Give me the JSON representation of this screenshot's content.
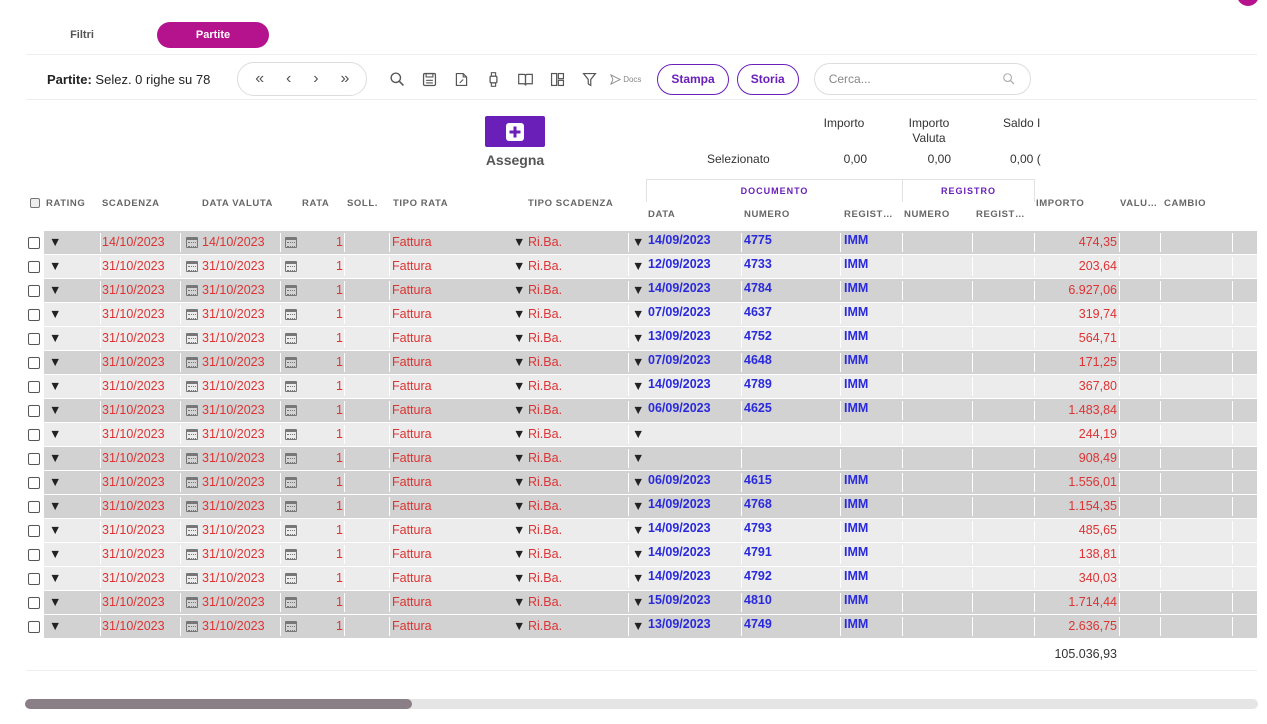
{
  "tabs": [
    {
      "label": "Filtri",
      "active": false
    },
    {
      "label": "Partite",
      "active": true
    }
  ],
  "toolbar": {
    "title": "Partite:",
    "selection_text": "Selez. 0 righe su 78",
    "pager": [
      "«",
      "‹",
      "›",
      "»"
    ],
    "docs_label": "Docs",
    "stampa_label": "Stampa",
    "storia_label": "Storia",
    "search_placeholder": "Cerca..."
  },
  "assegna": {
    "label": "Assegna"
  },
  "summary": {
    "headers": [
      "Importo",
      "Importo Valuta",
      "Saldo I"
    ],
    "row_label": "Selezionato",
    "values": [
      "0,00",
      "0,00",
      "0,00 ("
    ]
  },
  "groups": {
    "documento": "DOCUMENTO",
    "registro": "REGISTRO"
  },
  "columns": {
    "rating": "RATING",
    "scadenza": "SCADENZA",
    "data_valuta": "DATA VALUTA",
    "rata": "RATA",
    "soll": "SOLL.",
    "tipo_rata": "TIPO RATA",
    "tipo_scadenza": "TIPO SCADENZA",
    "doc_data": "DATA",
    "doc_numero": "NUMERO",
    "doc_regist": "REGIST…",
    "reg_numero": "NUMERO",
    "reg_regist": "REGIST…",
    "importo": "IMPORTO",
    "valuta": "VALU…",
    "cambio": "CAMBIO"
  },
  "rows": [
    {
      "scadenza": "14/10/2023",
      "data_valuta": "14/10/2023",
      "rata": "1",
      "tipo_rata": "Fattura",
      "tipo_scadenza": "Ri.Ba.",
      "doc_data": "14/09/2023",
      "doc_numero": "4775",
      "doc_regist": "IMM",
      "importo": "474,35",
      "shade": "dark"
    },
    {
      "scadenza": "31/10/2023",
      "data_valuta": "31/10/2023",
      "rata": "1",
      "tipo_rata": "Fattura",
      "tipo_scadenza": "Ri.Ba.",
      "doc_data": "12/09/2023",
      "doc_numero": "4733",
      "doc_regist": "IMM",
      "importo": "203,64",
      "shade": "light"
    },
    {
      "scadenza": "31/10/2023",
      "data_valuta": "31/10/2023",
      "rata": "1",
      "tipo_rata": "Fattura",
      "tipo_scadenza": "Ri.Ba.",
      "doc_data": "14/09/2023",
      "doc_numero": "4784",
      "doc_regist": "IMM",
      "importo": "6.927,06",
      "shade": "dark"
    },
    {
      "scadenza": "31/10/2023",
      "data_valuta": "31/10/2023",
      "rata": "1",
      "tipo_rata": "Fattura",
      "tipo_scadenza": "Ri.Ba.",
      "doc_data": "07/09/2023",
      "doc_numero": "4637",
      "doc_regist": "IMM",
      "importo": "319,74",
      "shade": "light"
    },
    {
      "scadenza": "31/10/2023",
      "data_valuta": "31/10/2023",
      "rata": "1",
      "tipo_rata": "Fattura",
      "tipo_scadenza": "Ri.Ba.",
      "doc_data": "13/09/2023",
      "doc_numero": "4752",
      "doc_regist": "IMM",
      "importo": "564,71",
      "shade": "light"
    },
    {
      "scadenza": "31/10/2023",
      "data_valuta": "31/10/2023",
      "rata": "1",
      "tipo_rata": "Fattura",
      "tipo_scadenza": "Ri.Ba.",
      "doc_data": "07/09/2023",
      "doc_numero": "4648",
      "doc_regist": "IMM",
      "importo": "171,25",
      "shade": "dark"
    },
    {
      "scadenza": "31/10/2023",
      "data_valuta": "31/10/2023",
      "rata": "1",
      "tipo_rata": "Fattura",
      "tipo_scadenza": "Ri.Ba.",
      "doc_data": "14/09/2023",
      "doc_numero": "4789",
      "doc_regist": "IMM",
      "importo": "367,80",
      "shade": "light"
    },
    {
      "scadenza": "31/10/2023",
      "data_valuta": "31/10/2023",
      "rata": "1",
      "tipo_rata": "Fattura",
      "tipo_scadenza": "Ri.Ba.",
      "doc_data": "06/09/2023",
      "doc_numero": "4625",
      "doc_regist": "IMM",
      "importo": "1.483,84",
      "shade": "dark"
    },
    {
      "scadenza": "31/10/2023",
      "data_valuta": "31/10/2023",
      "rata": "1",
      "tipo_rata": "Fattura",
      "tipo_scadenza": "Ri.Ba.",
      "doc_data": "",
      "doc_numero": "",
      "doc_regist": "",
      "importo": "244,19",
      "shade": "light"
    },
    {
      "scadenza": "31/10/2023",
      "data_valuta": "31/10/2023",
      "rata": "1",
      "tipo_rata": "Fattura",
      "tipo_scadenza": "Ri.Ba.",
      "doc_data": "",
      "doc_numero": "",
      "doc_regist": "",
      "importo": "908,49",
      "shade": "dark"
    },
    {
      "scadenza": "31/10/2023",
      "data_valuta": "31/10/2023",
      "rata": "1",
      "tipo_rata": "Fattura",
      "tipo_scadenza": "Ri.Ba.",
      "doc_data": "06/09/2023",
      "doc_numero": "4615",
      "doc_regist": "IMM",
      "importo": "1.556,01",
      "shade": "dark"
    },
    {
      "scadenza": "31/10/2023",
      "data_valuta": "31/10/2023",
      "rata": "1",
      "tipo_rata": "Fattura",
      "tipo_scadenza": "Ri.Ba.",
      "doc_data": "14/09/2023",
      "doc_numero": "4768",
      "doc_regist": "IMM",
      "importo": "1.154,35",
      "shade": "dark"
    },
    {
      "scadenza": "31/10/2023",
      "data_valuta": "31/10/2023",
      "rata": "1",
      "tipo_rata": "Fattura",
      "tipo_scadenza": "Ri.Ba.",
      "doc_data": "14/09/2023",
      "doc_numero": "4793",
      "doc_regist": "IMM",
      "importo": "485,65",
      "shade": "light"
    },
    {
      "scadenza": "31/10/2023",
      "data_valuta": "31/10/2023",
      "rata": "1",
      "tipo_rata": "Fattura",
      "tipo_scadenza": "Ri.Ba.",
      "doc_data": "14/09/2023",
      "doc_numero": "4791",
      "doc_regist": "IMM",
      "importo": "138,81",
      "shade": "light"
    },
    {
      "scadenza": "31/10/2023",
      "data_valuta": "31/10/2023",
      "rata": "1",
      "tipo_rata": "Fattura",
      "tipo_scadenza": "Ri.Ba.",
      "doc_data": "14/09/2023",
      "doc_numero": "4792",
      "doc_regist": "IMM",
      "importo": "340,03",
      "shade": "light"
    },
    {
      "scadenza": "31/10/2023",
      "data_valuta": "31/10/2023",
      "rata": "1",
      "tipo_rata": "Fattura",
      "tipo_scadenza": "Ri.Ba.",
      "doc_data": "15/09/2023",
      "doc_numero": "4810",
      "doc_regist": "IMM",
      "importo": "1.714,44",
      "shade": "dark"
    },
    {
      "scadenza": "31/10/2023",
      "data_valuta": "31/10/2023",
      "rata": "1",
      "tipo_rata": "Fattura",
      "tipo_scadenza": "Ri.Ba.",
      "doc_data": "13/09/2023",
      "doc_numero": "4749",
      "doc_regist": "IMM",
      "importo": "2.636,75",
      "shade": "dark"
    }
  ],
  "total": "105.036,93",
  "colors": {
    "accent": "#b5128e",
    "purple": "#6a1fb8",
    "red_text": "#dd3333",
    "blue_text": "#2a2add"
  }
}
